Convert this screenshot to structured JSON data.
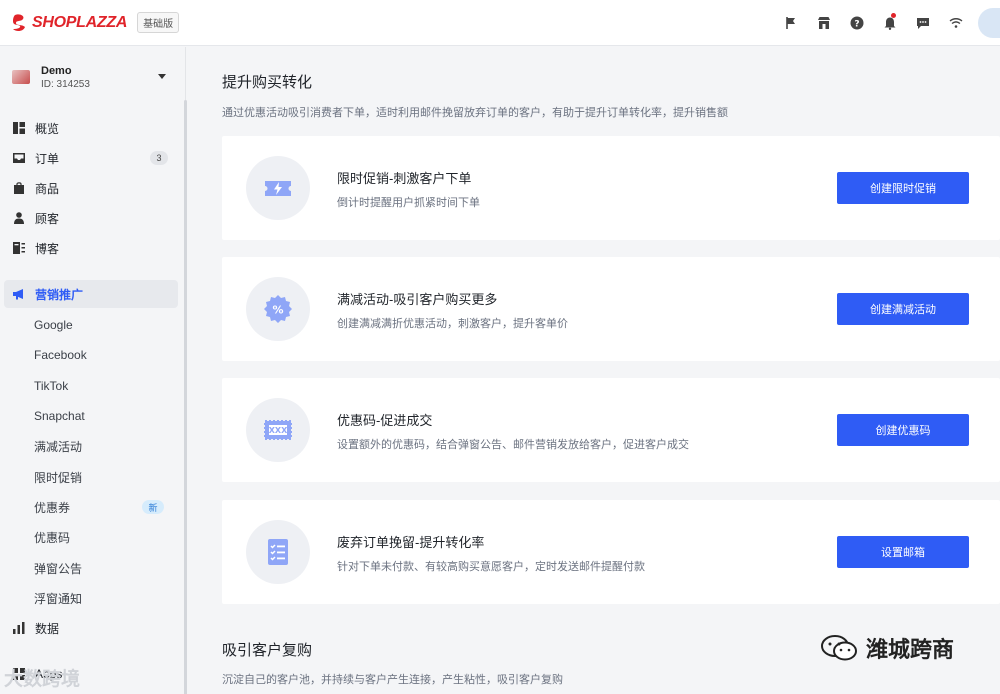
{
  "header": {
    "brand": "SHOPLAZZA",
    "plan": "基础版",
    "icons": [
      "flag-icon",
      "store-icon",
      "help-icon",
      "bell-icon",
      "chat-icon",
      "wifi-icon"
    ]
  },
  "sidebar": {
    "store_name": "Demo",
    "store_id": "ID: 314253",
    "items": [
      {
        "label": "概览",
        "icon": "overview-icon"
      },
      {
        "label": "订单",
        "icon": "inbox-icon",
        "count": "3"
      },
      {
        "label": "商品",
        "icon": "bag-icon"
      },
      {
        "label": "顾客",
        "icon": "person-icon"
      },
      {
        "label": "博客",
        "icon": "blog-icon"
      },
      {
        "label": "营销推广",
        "icon": "megaphone-icon",
        "active": true
      }
    ],
    "sub_items": [
      "Google",
      "Facebook",
      "TikTok",
      "Snapchat",
      "满减活动",
      "限时促销",
      "优惠券",
      "优惠码",
      "弹窗公告",
      "浮窗通知"
    ],
    "new_badge": "新",
    "data_label": "数据",
    "apps_label": "Apps"
  },
  "main": {
    "section1_title": "提升购买转化",
    "section1_desc": "通过优惠活动吸引消费者下单，适时利用邮件挽留放弃订单的客户，有助于提升订单转化率，提升销售额",
    "cards": [
      {
        "title": "限时促销-刺激客户下单",
        "desc": "倒计时提醒用户抓紧时间下单",
        "button": "创建限时促销",
        "icon": "flash-ticket-icon"
      },
      {
        "title": "满减活动-吸引客户购买更多",
        "desc": "创建满减满折优惠活动，刺激客户，提升客单价",
        "button": "创建满减活动",
        "icon": "percent-badge-icon"
      },
      {
        "title": "优惠码-促进成交",
        "desc": "设置额外的优惠码，结合弹窗公告、邮件营销发放给客户，促进客户成交",
        "button": "创建优惠码",
        "icon": "coupon-code-icon"
      },
      {
        "title": "废弃订单挽留-提升转化率",
        "desc": "针对下单未付款、有较高购买意愿客户，定时发送邮件提醒付款",
        "button": "设置邮箱",
        "icon": "checklist-icon"
      }
    ],
    "section2_title": "吸引客户复购",
    "section2_desc": "沉淀自己的客户池，并持续与客户产生连接，产生粘性，吸引客户复购"
  },
  "watermark": {
    "right": "潍城跨商",
    "left": "大数跨境"
  },
  "colors": {
    "accent": "#2f5cf5",
    "brand": "#e0242a",
    "icon_fill": "#8fa6f7"
  }
}
